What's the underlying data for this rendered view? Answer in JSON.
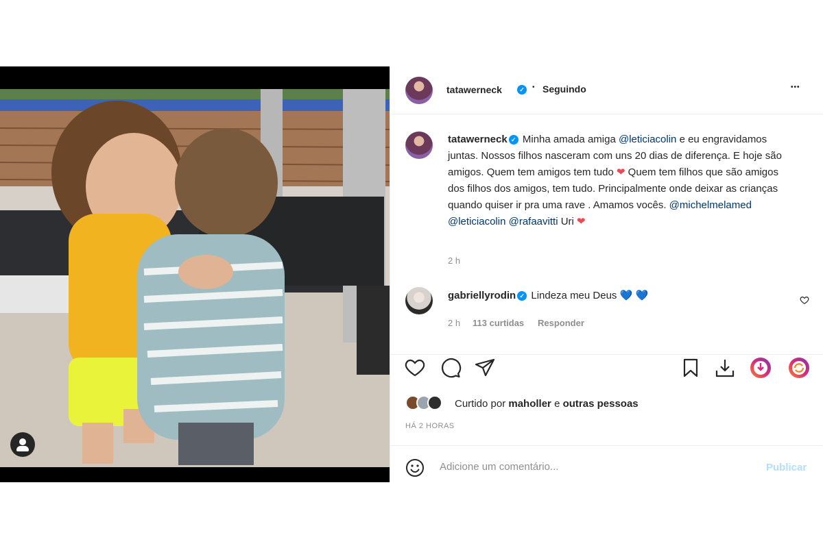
{
  "post": {
    "username": "tatawerneck",
    "separator": "•",
    "follow_status": "Seguindo",
    "more_label": "•••",
    "verified_mark": "✓"
  },
  "caption": {
    "username": "tatawerneck",
    "part1": " Minha amada amiga ",
    "mention1": "@leticiacolin",
    "part2": " e eu engravidamos juntas. Nossos filhos nasceram com uns 20 dias de diferença. E hoje são amigos. Quem tem amigos tem tudo ",
    "part3": " Quem tem filhos que são amigos dos filhos dos amigos, tem tudo. Principalmente onde deixar as crianças quando quiser ir pra uma rave . Amamos vocês. ",
    "mention2": "@michelmelamed",
    "mention3": "@leticiacolin",
    "mention4": "@rafaavitti",
    "part4": " Uri ",
    "heart": "❤",
    "time": "2 h"
  },
  "comment": {
    "username": "gabriellyrodin",
    "text": " Lindeza meu Deus ",
    "hearts": "💙 💙",
    "time": "2 h",
    "likes": "113 curtidas",
    "reply": "Responder"
  },
  "likes": {
    "prefix": "Curtido por ",
    "user": "maholler",
    "and": " e ",
    "others": "outras pessoas"
  },
  "time_ago": "HÁ 2 HORAS",
  "add_comment": {
    "placeholder": "Adicione um comentário...",
    "publish": "Publicar"
  },
  "colors": {
    "accent": "#0095f6",
    "link": "#00376b",
    "heart": "#ed4956",
    "publish_disabled": "#b2dffc"
  },
  "icons": {
    "like": "heart-icon",
    "comment": "comment-icon",
    "share": "send-icon",
    "save": "bookmark-icon",
    "download": "download-icon",
    "ext1": "extension-download-icon",
    "ext2": "extension-refresh-icon",
    "emoji": "emoji-icon"
  }
}
